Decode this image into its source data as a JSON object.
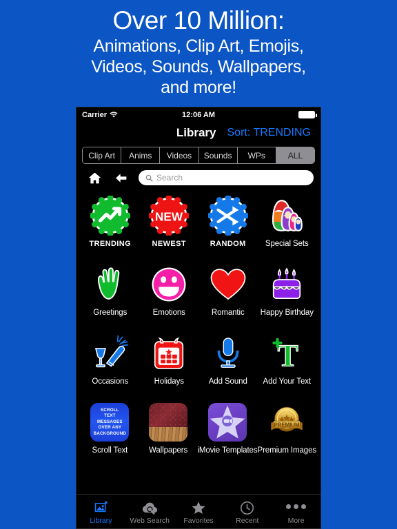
{
  "promo": {
    "line1": "Over 10 Million:",
    "line2": "Animations, Clip Art, Emojis,",
    "line3": "Videos, Sounds, Wallpapers,",
    "line4": "and more!"
  },
  "colors": {
    "background": "#0B55C4",
    "accent": "#1479FF",
    "screen": "#000000",
    "inactive": "#8e8e93"
  },
  "status_bar": {
    "carrier": "Carrier",
    "time": "12:06 AM",
    "wifi_icon": "wifi-icon",
    "battery_icon": "battery-icon"
  },
  "nav_bar": {
    "title": "Library",
    "sort_label": "Sort: TRENDING"
  },
  "segmented_control": {
    "options": [
      "Clip Art",
      "Anims",
      "Videos",
      "Sounds",
      "WPs",
      "ALL"
    ],
    "selected": "ALL"
  },
  "search_row": {
    "home_icon": "home-icon",
    "back_icon": "back-arrow-icon",
    "search_icon": "search-icon",
    "placeholder": "Search",
    "value": ""
  },
  "grid": {
    "rows": [
      [
        {
          "label": "TRENDING",
          "icon": "trending-badge-icon",
          "caps": true
        },
        {
          "label": "NEWEST",
          "icon": "new-badge-icon",
          "caps": true
        },
        {
          "label": "RANDOM",
          "icon": "shuffle-badge-icon",
          "caps": true
        },
        {
          "label": "Special Sets",
          "icon": "nesting-dolls-icon",
          "caps": false
        }
      ],
      [
        {
          "label": "Greetings",
          "icon": "waving-hand-icon",
          "caps": false
        },
        {
          "label": "Emotions",
          "icon": "smiley-face-icon",
          "caps": false
        },
        {
          "label": "Romantic",
          "icon": "heart-icon",
          "caps": false
        },
        {
          "label": "Happy Birthday",
          "icon": "birthday-cake-icon",
          "caps": false
        }
      ],
      [
        {
          "label": "Occasions",
          "icon": "champagne-toast-icon",
          "caps": false
        },
        {
          "label": "Holidays",
          "icon": "calendar-icon",
          "caps": false
        },
        {
          "label": "Add Sound",
          "icon": "microphone-icon",
          "caps": false
        },
        {
          "label": "Add Your Text",
          "icon": "add-text-icon",
          "caps": false
        }
      ],
      [
        {
          "label": "Scroll Text",
          "icon": "scroll-text-thumbnail",
          "caps": false
        },
        {
          "label": "Wallpapers",
          "icon": "wallpaper-thumbnail",
          "caps": false
        },
        {
          "label": "iMovie Templates",
          "icon": "imovie-thumbnail",
          "caps": false
        },
        {
          "label": "Premium Images",
          "icon": "premium-badge-thumbnail",
          "caps": false
        }
      ]
    ]
  },
  "scroll_text_thumb": {
    "lines": [
      "SCROLL",
      "TEXT",
      "MESSAGES",
      "OVER ANY",
      "BACKGROUND"
    ]
  },
  "premium_thumb": {
    "ribbon_text": "PREMIUM"
  },
  "tab_bar": {
    "tabs": [
      {
        "label": "Library",
        "icon": "photo-library-icon",
        "active": true
      },
      {
        "label": "Web Search",
        "icon": "cloud-search-icon",
        "active": false
      },
      {
        "label": "Favorites",
        "icon": "star-icon",
        "active": false
      },
      {
        "label": "Recent",
        "icon": "clock-icon",
        "active": false
      },
      {
        "label": "More",
        "icon": "ellipsis-icon",
        "active": false
      }
    ]
  }
}
